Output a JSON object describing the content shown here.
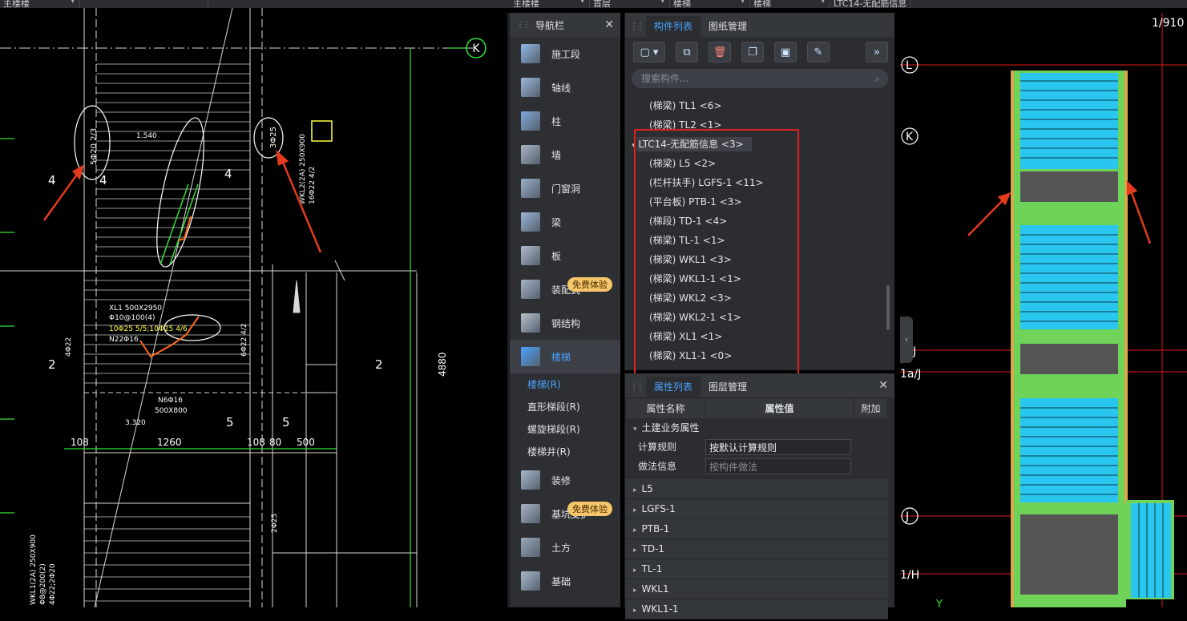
{
  "top_dropdowns": [
    "主楼楼",
    "首层",
    "楼梯",
    "楼梯",
    "LTC14-无配筋信息"
  ],
  "cad_left": {
    "axis_label": "K",
    "annotations": [
      "5Φ20 2/3",
      "3Φ25",
      "1.540",
      "4",
      "4",
      "4",
      "2",
      "2",
      "5",
      "5",
      "108",
      "1260",
      "108",
      "80",
      "500",
      "4880",
      "3.320",
      "N6Φ16",
      "500X800",
      "XL1 500X2950",
      "Φ10@100(4)",
      "10Φ25 5/5;10Φ25 4/6",
      "N22Φ16",
      "WKL2(2A) 250X900",
      "16Φ22 4/2",
      "6Φ22 4/2",
      "4Φ22",
      "2Φ25",
      "WKL1(2A) 250X900",
      "Φ8@200(2)",
      "4Φ22;2Φ20"
    ]
  },
  "nav_panel": {
    "title": "导航栏",
    "items": [
      {
        "label": "施工段",
        "icon": "construction-section-icon",
        "color": "#8fb8e8"
      },
      {
        "label": "轴线",
        "icon": "axis-grid-icon",
        "color": "#9ab6d8"
      },
      {
        "label": "柱",
        "icon": "column-icon",
        "color": "#7ea8d8"
      },
      {
        "label": "墙",
        "icon": "wall-icon",
        "color": "#a8b4c4"
      },
      {
        "label": "门窗洞",
        "icon": "door-window-icon",
        "color": "#9ab0c8"
      },
      {
        "label": "梁",
        "icon": "beam-icon",
        "color": "#9ab6d8"
      },
      {
        "label": "板",
        "icon": "slab-icon",
        "color": "#b0bccc"
      },
      {
        "label": "装配式",
        "icon": "prefab-icon",
        "color": "#a6b4c6",
        "badge": "免费体验"
      },
      {
        "label": "钢结构",
        "icon": "steel-structure-icon",
        "color": "#b8c0cc"
      },
      {
        "label": "楼梯",
        "icon": "stairs-icon",
        "color": "#4aa3ff",
        "active": true
      }
    ],
    "sub_items": [
      {
        "label": "楼梯(R)",
        "active": true
      },
      {
        "label": "直形梯段(R)"
      },
      {
        "label": "螺旋梯段(R)"
      },
      {
        "label": "楼梯井(R)"
      }
    ],
    "items_after": [
      {
        "label": "装修",
        "icon": "decoration-icon",
        "color": "#a8b8c8"
      },
      {
        "label": "基坑支护",
        "icon": "foundation-pit-icon",
        "color": "#a8b4c4",
        "badge": "免费体验"
      },
      {
        "label": "土方",
        "icon": "earthwork-icon",
        "color": "#9aa8b8"
      },
      {
        "label": "基础",
        "icon": "foundation-icon",
        "color": "#a8b8c8"
      }
    ]
  },
  "component_panel": {
    "tabs": [
      "构件列表",
      "图纸管理"
    ],
    "active_tab": "构件列表",
    "search_placeholder": "搜索构件...",
    "tree": [
      {
        "label": "(梯梁) TL1 <6>"
      },
      {
        "label": "(梯梁) TL2 <1>"
      },
      {
        "label": "LTC14-无配筋信息 <3>",
        "group": true
      },
      {
        "label": "(梯梁) L5 <2>"
      },
      {
        "label": "(栏杆扶手) LGFS-1 <11>"
      },
      {
        "label": "(平台板) PTB-1 <3>"
      },
      {
        "label": "(梯段) TD-1 <4>"
      },
      {
        "label": "(梯梁) TL-1 <1>"
      },
      {
        "label": "(梯梁) WKL1 <3>"
      },
      {
        "label": "(梯梁) WKL1-1 <1>"
      },
      {
        "label": "(梯梁) WKL2 <3>"
      },
      {
        "label": "(梯梁) WKL2-1 <1>"
      },
      {
        "label": "(梯梁) XL1 <1>"
      },
      {
        "label": "(梯梁) XL1-1 <0>"
      }
    ]
  },
  "property_panel": {
    "tabs": [
      "属性列表",
      "图层管理"
    ],
    "active_tab": "属性列表",
    "columns": [
      "属性名称",
      "属性值",
      "附加"
    ],
    "section": "土建业务属性",
    "rows": [
      {
        "name": "计算规则",
        "value": "按默认计算规则"
      },
      {
        "name": "做法信息",
        "value": "按构件做法"
      }
    ],
    "collapsed": [
      "L5",
      "LGFS-1",
      "PTB-1",
      "TD-1",
      "TL-1",
      "WKL1",
      "WKL1-1"
    ]
  },
  "cad_right": {
    "scale": "1/910",
    "axis_labels": [
      "L",
      "K",
      "J",
      "1a/J",
      "J",
      "1/H",
      "Y"
    ]
  },
  "colors": {
    "accent_blue": "#4aa3ff",
    "highlight_red": "#e02020",
    "stair_cyan": "#29c7f0",
    "slab_green": "#6fd35a",
    "cad_white": "#ffffff",
    "annot_green": "#35e035",
    "annot_yellow": "#ffff40"
  }
}
